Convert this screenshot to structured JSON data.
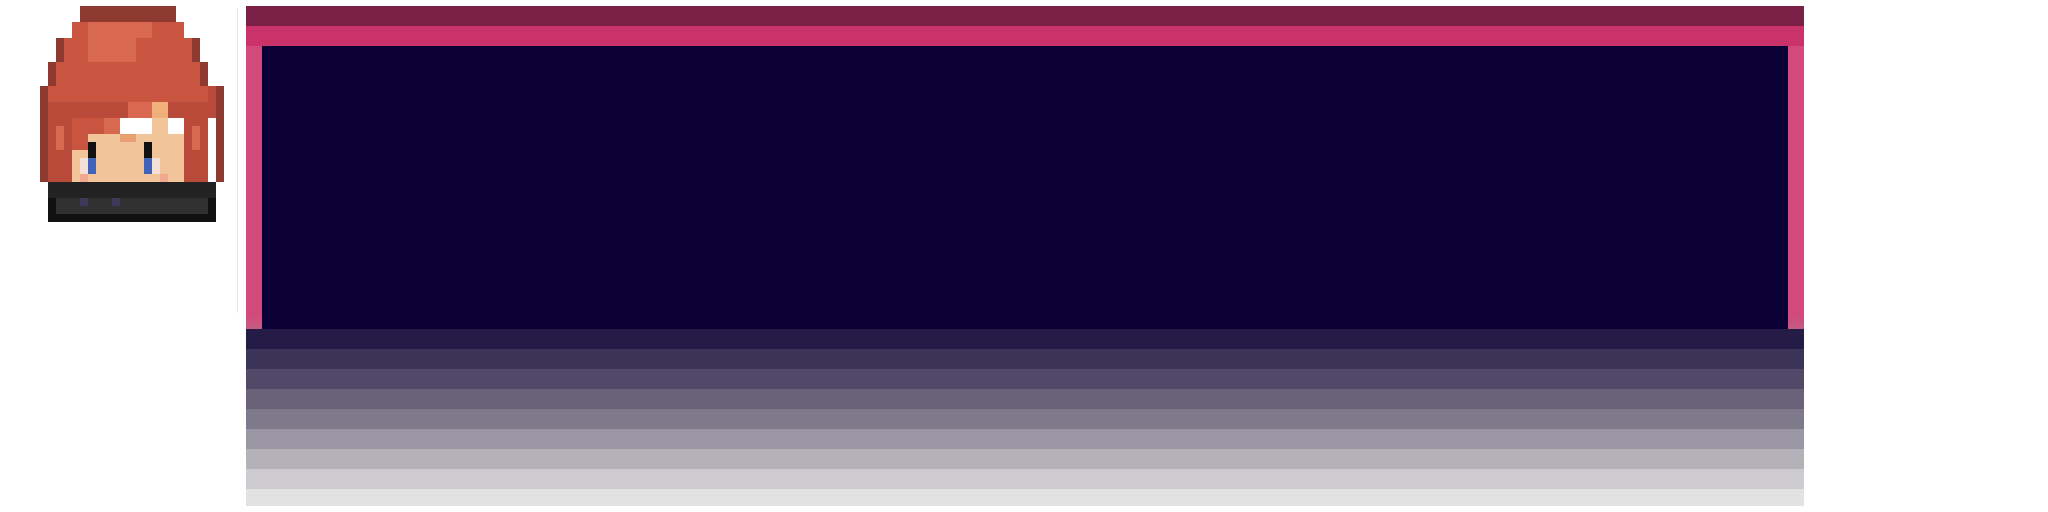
{
  "dialogue": {
    "speaker": "",
    "text": ""
  },
  "colors": {
    "frame_dark": "#7a1f45",
    "frame_accent": "#c9336a",
    "frame_side": "#d24a7b",
    "panel_bg": "#0a0035"
  },
  "portrait": {
    "icon": "red-haired-character-portrait"
  }
}
